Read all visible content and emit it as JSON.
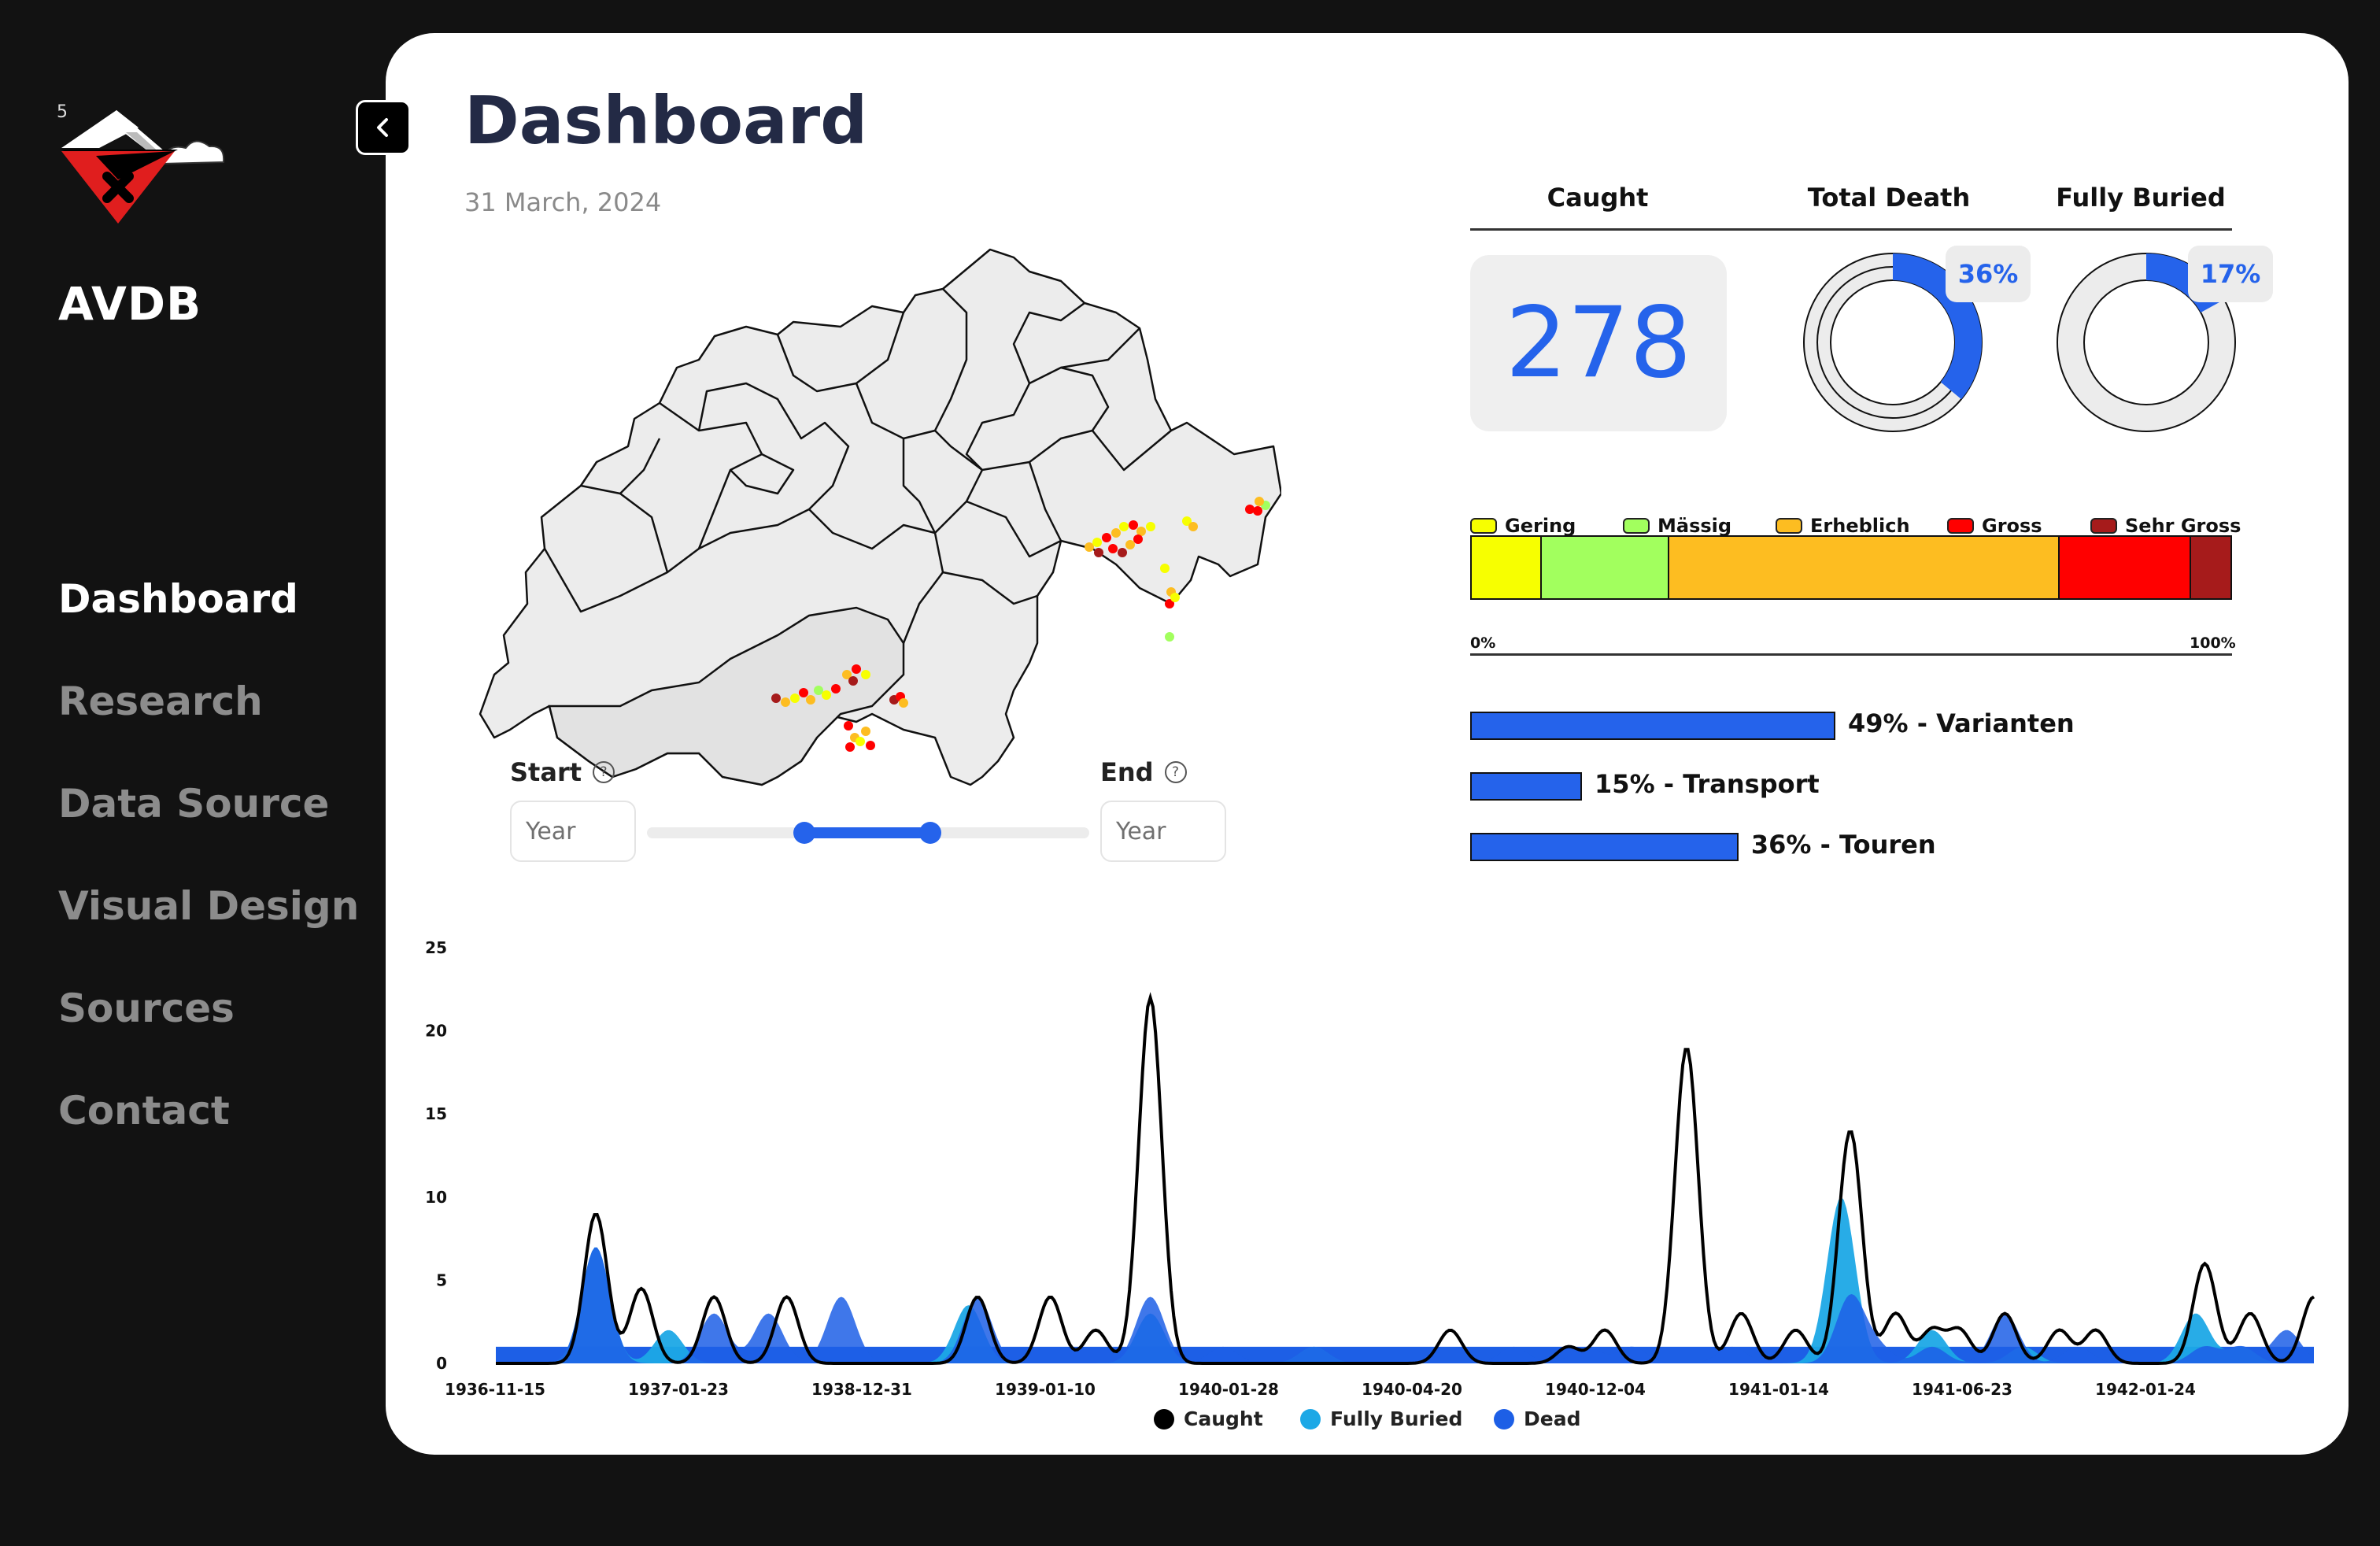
{
  "sidebar": {
    "logo_number": "5",
    "brand": "AVDB",
    "items": [
      {
        "label": "Dashboard",
        "active": true
      },
      {
        "label": "Research",
        "active": false
      },
      {
        "label": "Data Source",
        "active": false
      },
      {
        "label": "Visual Design",
        "active": false
      },
      {
        "label": "Sources",
        "active": false
      },
      {
        "label": "Contact",
        "active": false
      }
    ]
  },
  "header": {
    "title": "Dashboard",
    "date": "31 March, 2024"
  },
  "filters": {
    "start_label": "Start",
    "end_label": "End",
    "start_placeholder": "Year",
    "end_placeholder": "Year",
    "range_fraction": [
      0.37,
      0.66
    ]
  },
  "stats": {
    "caught_label": "Caught",
    "death_label": "Total Death",
    "buried_label": "Fully Buried",
    "caught_value": "278",
    "death_pct": "36%",
    "buried_pct": "17%",
    "death_fraction": 0.36,
    "buried_fraction": 0.17
  },
  "danger_levels": {
    "tick_start": "0%",
    "tick_end": "100%",
    "levels": [
      {
        "name": "Gering",
        "color": "#f7ff00",
        "share": 0.092
      },
      {
        "name": "Mässig",
        "color": "#a2ff5e",
        "share": 0.168
      },
      {
        "name": "Erheblich",
        "color": "#fdbd21",
        "share": 0.515
      },
      {
        "name": "Gross",
        "color": "#ff0000",
        "share": 0.173
      },
      {
        "name": "Sehr Gross",
        "color": "#a61b1b",
        "share": 0.052
      }
    ]
  },
  "activity": [
    {
      "label": "49% - Varianten",
      "value": 0.49
    },
    {
      "label": "15% - Transport",
      "value": 0.15
    },
    {
      "label": "36% - Touren",
      "value": 0.36
    }
  ],
  "map": {
    "marker_colors": {
      "gering": "#f7ff00",
      "maessig": "#a2ff5e",
      "erheblich": "#fdbd21",
      "gross": "#ff0000",
      "sehr_gross": "#a61b1b"
    }
  },
  "chart_data": {
    "type": "area",
    "x_ticks": [
      "1936-11-15",
      "1937-01-23",
      "1938-12-31",
      "1939-01-10",
      "1940-01-28",
      "1940-04-20",
      "1940-12-04",
      "1941-01-14",
      "1941-06-23",
      "1942-01-24"
    ],
    "y_ticks": [
      "0",
      "5",
      "10",
      "15",
      "20",
      "25"
    ],
    "ylim": [
      0,
      25
    ],
    "grid": false,
    "legend_position": "bottom",
    "series": [
      {
        "name": "Caught",
        "color": "#000000",
        "style": "line",
        "peaks": [
          [
            0.055,
            9.0
          ],
          [
            0.08,
            4.5
          ],
          [
            0.12,
            4.0
          ],
          [
            0.16,
            4.0
          ],
          [
            0.265,
            4.0
          ],
          [
            0.305,
            4.0
          ],
          [
            0.33,
            2.0
          ],
          [
            0.36,
            22.0
          ],
          [
            0.525,
            2.0
          ],
          [
            0.59,
            1.0
          ],
          [
            0.61,
            2.0
          ],
          [
            0.655,
            19.0
          ],
          [
            0.685,
            3.0
          ],
          [
            0.715,
            2.0
          ],
          [
            0.745,
            14.0
          ],
          [
            0.77,
            3.0
          ],
          [
            0.79,
            2.0
          ],
          [
            0.805,
            2.0
          ],
          [
            0.83,
            3.0
          ],
          [
            0.86,
            2.0
          ],
          [
            0.88,
            2.0
          ],
          [
            0.94,
            6.0
          ],
          [
            0.965,
            3.0
          ],
          [
            1.0,
            4.0
          ]
        ]
      },
      {
        "name": "Fully Buried",
        "color": "#1ca8e6",
        "style": "area",
        "peaks": [
          [
            0.055,
            7.0
          ],
          [
            0.095,
            2.0
          ],
          [
            0.26,
            3.5
          ],
          [
            0.36,
            3.0
          ],
          [
            0.45,
            1.0
          ],
          [
            0.74,
            10.0
          ],
          [
            0.79,
            2.0
          ],
          [
            0.84,
            1.0
          ],
          [
            0.935,
            3.0
          ],
          [
            0.96,
            1.0
          ]
        ]
      },
      {
        "name": "Dead",
        "color": "#1d5fe6",
        "style": "area",
        "peaks": [
          [
            0.055,
            7.0
          ],
          [
            0.12,
            3.0
          ],
          [
            0.15,
            3.0
          ],
          [
            0.19,
            4.0
          ],
          [
            0.265,
            4.0
          ],
          [
            0.36,
            4.0
          ],
          [
            0.4,
            1.0
          ],
          [
            0.45,
            1.0
          ],
          [
            0.56,
            1.0
          ],
          [
            0.6,
            1.0
          ],
          [
            0.625,
            1.0
          ],
          [
            0.68,
            1.0
          ],
          [
            0.745,
            4.0
          ],
          [
            0.76,
            1.0
          ],
          [
            0.79,
            1.0
          ],
          [
            0.83,
            3.0
          ],
          [
            0.87,
            1.0
          ],
          [
            0.94,
            1.0
          ],
          [
            0.96,
            1.0
          ],
          [
            0.985,
            2.0
          ]
        ]
      }
    ]
  }
}
